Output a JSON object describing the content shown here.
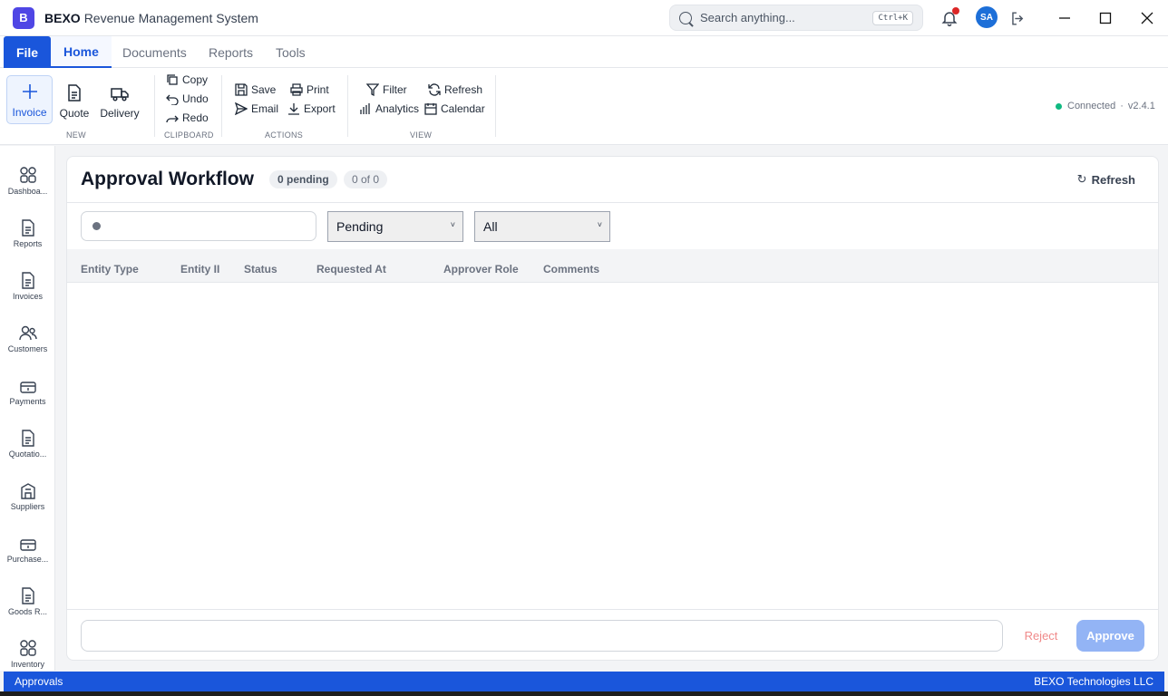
{
  "app": {
    "logo_letter": "B",
    "brand": "BEXO",
    "title": "Revenue Management System"
  },
  "search": {
    "placeholder": "Search anything...",
    "shortcut": "Ctrl+K"
  },
  "user": {
    "initials": "SA"
  },
  "ribbon_tabs": {
    "file": "File",
    "home": "Home",
    "documents": "Documents",
    "reports": "Reports",
    "tools": "Tools"
  },
  "ribbon": {
    "new": {
      "label": "NEW",
      "invoice": "Invoice",
      "quote": "Quote",
      "delivery": "Delivery"
    },
    "clipboard": {
      "label": "CLIPBOARD",
      "copy": "Copy",
      "undo": "Undo",
      "redo": "Redo"
    },
    "actions": {
      "label": "ACTIONS",
      "save": "Save",
      "print": "Print",
      "email": "Email",
      "export": "Export"
    },
    "view": {
      "label": "VIEW",
      "filter": "Filter",
      "refresh": "Refresh",
      "analytics": "Analytics",
      "calendar": "Calendar"
    },
    "connection": {
      "status": "Connected",
      "separator": "·",
      "version": "v2.4.1"
    }
  },
  "nav": {
    "items": [
      {
        "label": "Dashboa...",
        "icon": "grid-icon"
      },
      {
        "label": "Reports",
        "icon": "document-icon"
      },
      {
        "label": "Invoices",
        "icon": "document-icon"
      },
      {
        "label": "Customers",
        "icon": "users-icon"
      },
      {
        "label": "Payments",
        "icon": "wallet-icon"
      },
      {
        "label": "Quotatio...",
        "icon": "document-icon"
      },
      {
        "label": "Suppliers",
        "icon": "building-icon"
      },
      {
        "label": "Purchase...",
        "icon": "wallet-icon"
      },
      {
        "label": "Goods R...",
        "icon": "document-icon"
      },
      {
        "label": "Inventory",
        "icon": "grid-icon"
      }
    ]
  },
  "panel": {
    "title": "Approval Workflow",
    "pending_badge": "0 pending",
    "count_badge": "0 of 0",
    "refresh_label": "Refresh",
    "status_filter": "Pending",
    "type_filter": "All",
    "columns": [
      "Entity Type",
      "Entity II",
      "Status",
      "Requested At",
      "Approver Role",
      "Comments"
    ],
    "rows": [],
    "reject_label": "Reject",
    "approve_label": "Approve"
  },
  "statusbar": {
    "left": "Approvals",
    "right": "BEXO Technologies LLC"
  },
  "colors": {
    "accent": "#1a56db",
    "logo": "#4f46e5",
    "connected": "#10b981",
    "reject": "#f08a8a",
    "approve_disabled": "#93b4f5"
  }
}
